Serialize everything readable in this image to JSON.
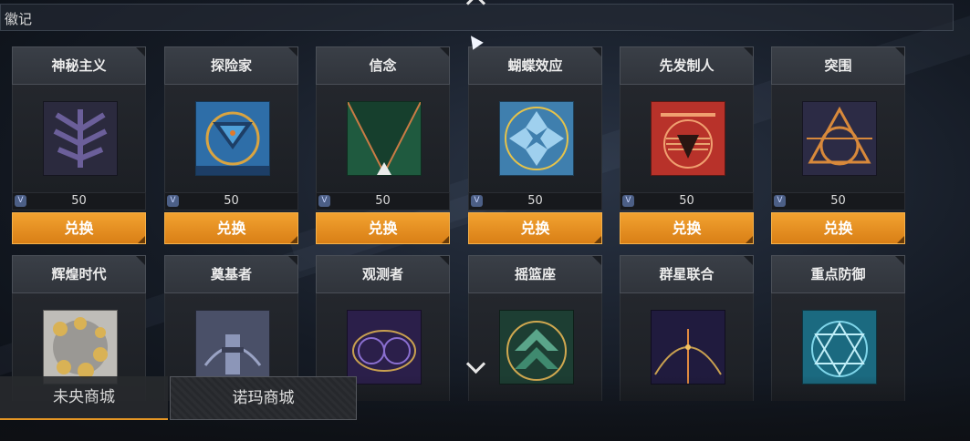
{
  "header": {
    "title": "徽记"
  },
  "row1": [
    {
      "name": "神秘主义",
      "price": "50",
      "button": "兑换",
      "icon": "mysticism-emblem-icon"
    },
    {
      "name": "探险家",
      "price": "50",
      "button": "兑换",
      "icon": "explorer-emblem-icon"
    },
    {
      "name": "信念",
      "price": "50",
      "button": "兑换",
      "icon": "faith-emblem-icon"
    },
    {
      "name": "蝴蝶效应",
      "price": "50",
      "button": "兑换",
      "icon": "butterfly-effect-emblem-icon"
    },
    {
      "name": "先发制人",
      "price": "50",
      "button": "兑换",
      "icon": "preemptive-emblem-icon"
    },
    {
      "name": "突围",
      "price": "50",
      "button": "兑换",
      "icon": "breakout-emblem-icon"
    }
  ],
  "row2": [
    {
      "name": "辉煌时代",
      "icon": "glorious-era-emblem-icon"
    },
    {
      "name": "奠基者",
      "icon": "founder-emblem-icon"
    },
    {
      "name": "观测者",
      "icon": "observer-emblem-icon"
    },
    {
      "name": "摇篮座",
      "icon": "cradle-emblem-icon"
    },
    {
      "name": "群星联合",
      "icon": "star-union-emblem-icon"
    },
    {
      "name": "重点防御",
      "icon": "key-defense-emblem-icon"
    }
  ],
  "tabs": {
    "weiyang": "未央商城",
    "nuoma": "诺玛商城"
  },
  "colors": {
    "accent": "#e8921f",
    "currency": "#4c5f86"
  }
}
